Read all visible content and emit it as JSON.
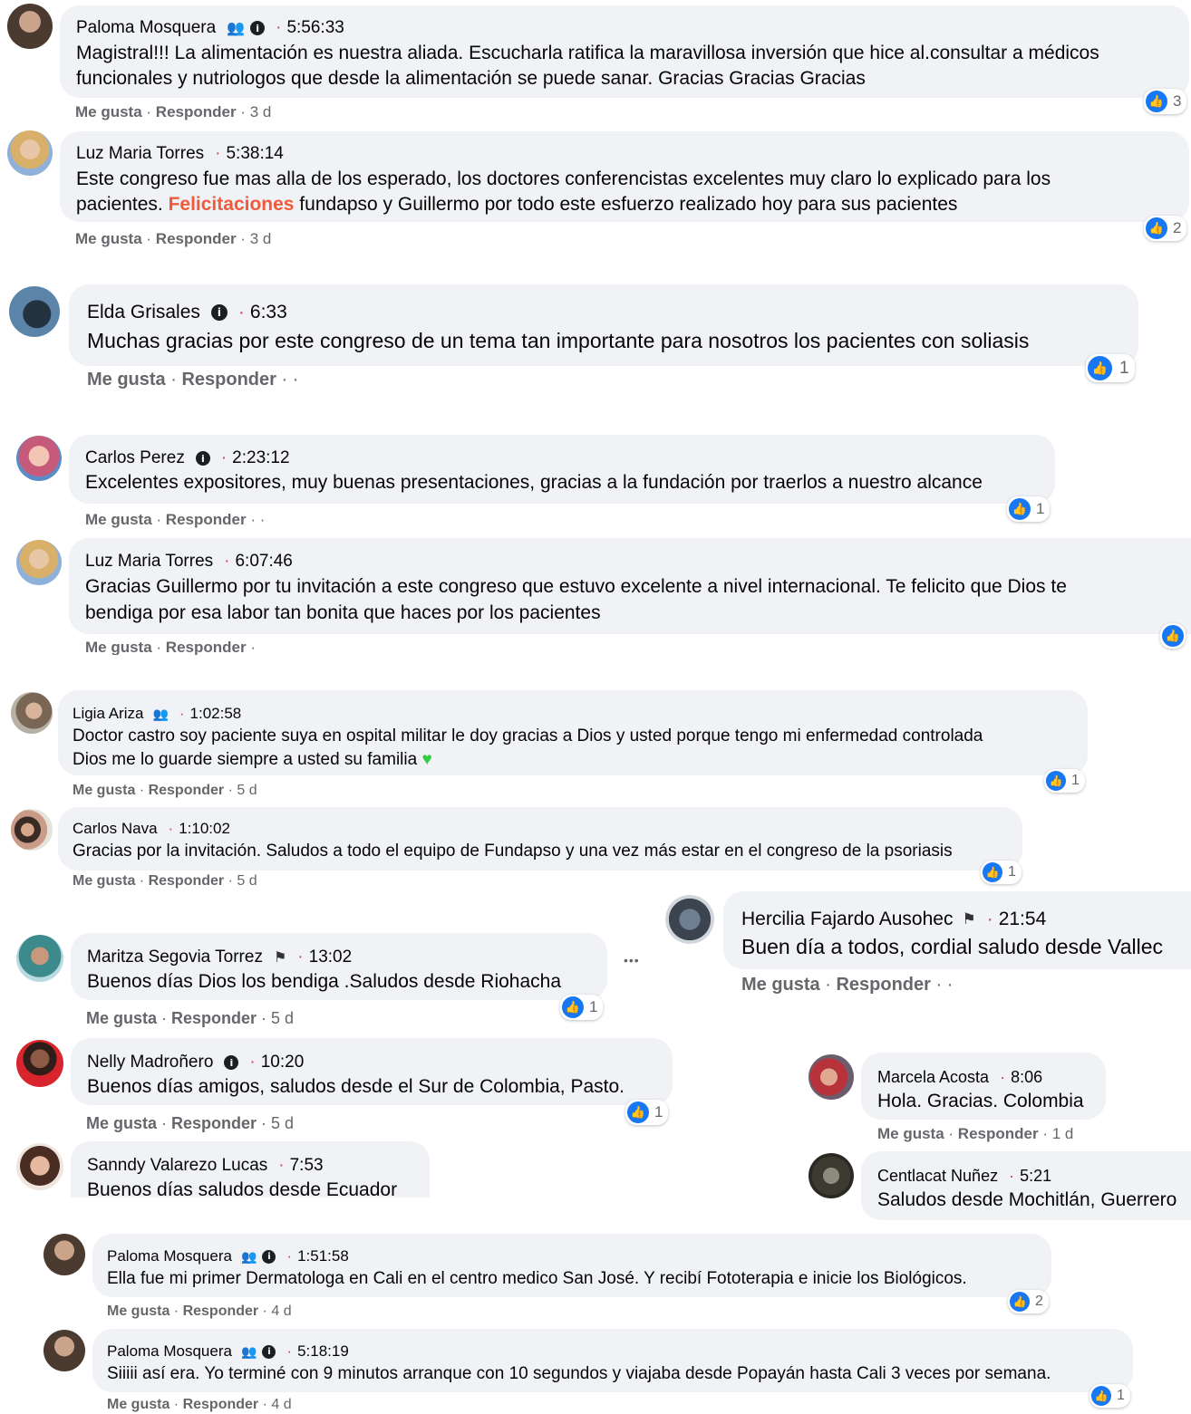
{
  "comments": [
    {
      "name": "Paloma Mosquera",
      "time": "5:56:33",
      "text1": "Magistral!!! La alimentación es nuestra aliada. Escucharla ratifica la maravillosa inversión que hice al.consultar a médicos",
      "text2": "funcionales y nutriologos que desde la alimentación se puede sanar. Gracias Gracias Gracias",
      "like": "Me gusta",
      "reply": "Responder",
      "age": "3 d",
      "reactions": "3"
    },
    {
      "name": "Luz Maria Torres",
      "time": "5:38:14",
      "text1": "Este congreso fue mas alla de los esperado, los doctores conferencistas excelentes muy claro lo explicado para los",
      "text2a": "pacientes. ",
      "text2hl": "Felicitaciones",
      "text2b": " fundapso y Guillermo por todo este esfuerzo realizado hoy para sus pacientes",
      "like": "Me gusta",
      "reply": "Responder",
      "age": "3 d",
      "reactions": "2"
    },
    {
      "name": "Elda Grisales",
      "time": "6:33",
      "text1": "Muchas gracias por este congreso de un tema tan importante para nosotros los pacientes con soliasis",
      "like": "Me gusta",
      "reply": "Responder",
      "age": "·",
      "reactions": "1"
    },
    {
      "name": "Carlos Perez",
      "time": "2:23:12",
      "text1": "Excelentes expositores, muy buenas presentaciones, gracias a la fundación por traerlos a nuestro alcance",
      "like": "Me gusta",
      "reply": "Responder",
      "age": "·",
      "reactions": "1"
    },
    {
      "name": "Luz Maria Torres",
      "time": "6:07:46",
      "text1": "Gracias Guillermo por tu invitación a este congreso que estuvo excelente a nivel internacional. Te felicito que Dios te",
      "text2": "bendiga por esa labor tan bonita que haces por los pacientes",
      "like": "Me gusta",
      "reply": "Responder",
      "age": ""
    },
    {
      "name": "Ligia Ariza",
      "time": "1:02:58",
      "text1": "Doctor castro soy paciente suya en ospital militar le doy gracias a Dios y usted porque tengo mi enfermedad controlada",
      "text2": "Dios me lo guarde siempre a usted su familia",
      "like": "Me gusta",
      "reply": "Responder",
      "age": "5 d",
      "reactions": "1"
    },
    {
      "name": "Carlos Nava",
      "time": "1:10:02",
      "text1": "Gracias por la invitación. Saludos a todo el equipo de Fundapso y una vez más estar en el congreso de la psoriasis",
      "like": "Me gusta",
      "reply": "Responder",
      "age": "5 d",
      "reactions": "1"
    },
    {
      "name": "Hercilia Fajardo Ausohec",
      "time": "21:54",
      "text1": "Buen día a todos, cordial saludo desde Vallec",
      "like": "Me gusta",
      "reply": "Responder",
      "age": "·"
    },
    {
      "name": "Maritza Segovia Torrez",
      "time": "13:02",
      "text1": "Buenos días Dios los bendiga .Saludos desde Riohacha",
      "like": "Me gusta",
      "reply": "Responder",
      "age": "5 d",
      "reactions": "1",
      "more": "•••"
    },
    {
      "name": "Nelly Madroñero",
      "time": "10:20",
      "text1": "Buenos días amigos, saludos desde el Sur de Colombia, Pasto.",
      "like": "Me gusta",
      "reply": "Responder",
      "age": "5 d",
      "reactions": "1"
    },
    {
      "name": "Marcela Acosta",
      "time": "8:06",
      "text1": "Hola. Gracias. Colombia",
      "like": "Me gusta",
      "reply": "Responder",
      "age": "1 d"
    },
    {
      "name": "Sanndy Valarezo Lucas",
      "time": "7:53",
      "text1": "Buenos días saludos desde Ecuador"
    },
    {
      "name": "Centlacat Nuñez",
      "time": "5:21",
      "text1": "Saludos desde Mochitlán, Guerrero"
    },
    {
      "name": "Paloma Mosquera",
      "time": "1:51:58",
      "text1": "Ella fue mi primer Dermatologa en Cali en el centro medico San José. Y recibí Fototerapia e inicie los Biológicos.",
      "like": "Me gusta",
      "reply": "Responder",
      "age": "4 d",
      "reactions": "2"
    },
    {
      "name": "Paloma Mosquera",
      "time": "5:18:19",
      "text1": "Siiiii así era. Yo terminé con 9 minutos arranque con 10 segundos y viajaba desde Popayán hasta Cali 3 veces por semana.",
      "like": "Me gusta",
      "reply": "Responder",
      "age": "4 d",
      "reactions": "1"
    }
  ],
  "colors": {
    "bubble": "#f0f2f5",
    "like_blue": "#1877f2",
    "highlight": "#f05a3a",
    "meta": "#65676b"
  },
  "icons": {
    "group": "group-icon",
    "info": "info-icon",
    "flag": "flag-icon",
    "like": "like-icon",
    "heart": "green-heart-icon"
  }
}
